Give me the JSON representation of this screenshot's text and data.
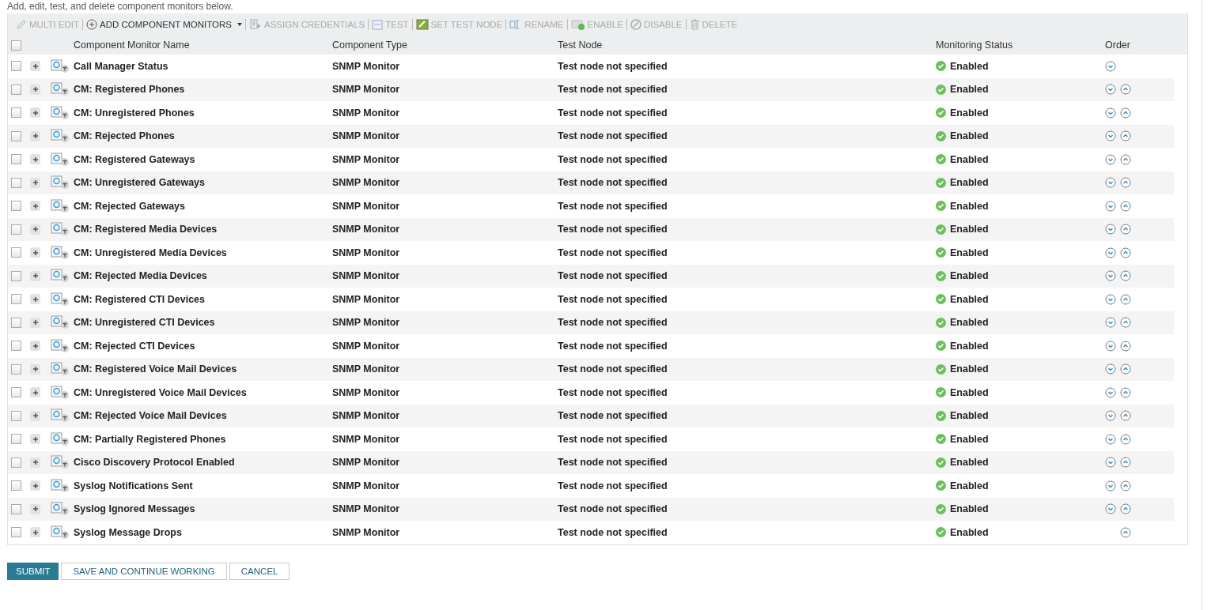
{
  "intro": "Add, edit, test, and delete component monitors below.",
  "toolbar": [
    {
      "kind": "edit",
      "label": "MULTI EDIT",
      "disabled": true
    },
    {
      "kind": "add",
      "label": "ADD COMPONENT MONITORS",
      "disabled": false,
      "dropdown": true
    },
    {
      "kind": "credentials",
      "label": "ASSIGN CREDENTIALS",
      "disabled": true
    },
    {
      "kind": "test",
      "label": "TEST",
      "disabled": true
    },
    {
      "kind": "node",
      "label": "SET TEST NODE",
      "disabled": true
    },
    {
      "kind": "rename",
      "label": "RENAME",
      "disabled": true
    },
    {
      "kind": "enable",
      "label": "ENABLE",
      "disabled": true
    },
    {
      "kind": "disable",
      "label": "DISABLE",
      "disabled": true
    },
    {
      "kind": "delete",
      "label": "DELETE",
      "disabled": true
    }
  ],
  "columns": [
    "Component Monitor Name",
    "Component Type",
    "Test Node",
    "Monitoring Status",
    "Order"
  ],
  "header_checked": false,
  "rows": [
    {
      "name": "Call Manager Status",
      "type": "SNMP Monitor",
      "test_node": "Test node not specified",
      "status": "Enabled",
      "checked": false,
      "down": true,
      "up": false
    },
    {
      "name": "CM: Registered Phones",
      "type": "SNMP Monitor",
      "test_node": "Test node not specified",
      "status": "Enabled",
      "checked": false,
      "down": true,
      "up": true
    },
    {
      "name": "CM: Unregistered Phones",
      "type": "SNMP Monitor",
      "test_node": "Test node not specified",
      "status": "Enabled",
      "checked": false,
      "down": true,
      "up": true
    },
    {
      "name": "CM: Rejected Phones",
      "type": "SNMP Monitor",
      "test_node": "Test node not specified",
      "status": "Enabled",
      "checked": false,
      "down": true,
      "up": true
    },
    {
      "name": "CM: Registered Gateways",
      "type": "SNMP Monitor",
      "test_node": "Test node not specified",
      "status": "Enabled",
      "checked": false,
      "down": true,
      "up": true
    },
    {
      "name": "CM: Unregistered Gateways",
      "type": "SNMP Monitor",
      "test_node": "Test node not specified",
      "status": "Enabled",
      "checked": false,
      "down": true,
      "up": true
    },
    {
      "name": "CM: Rejected Gateways",
      "type": "SNMP Monitor",
      "test_node": "Test node not specified",
      "status": "Enabled",
      "checked": false,
      "down": true,
      "up": true
    },
    {
      "name": "CM: Registered Media Devices",
      "type": "SNMP Monitor",
      "test_node": "Test node not specified",
      "status": "Enabled",
      "checked": false,
      "down": true,
      "up": true
    },
    {
      "name": "CM: Unregistered Media Devices",
      "type": "SNMP Monitor",
      "test_node": "Test node not specified",
      "status": "Enabled",
      "checked": false,
      "down": true,
      "up": true
    },
    {
      "name": "CM: Rejected Media Devices",
      "type": "SNMP Monitor",
      "test_node": "Test node not specified",
      "status": "Enabled",
      "checked": false,
      "down": true,
      "up": true
    },
    {
      "name": "CM: Registered CTI Devices",
      "type": "SNMP Monitor",
      "test_node": "Test node not specified",
      "status": "Enabled",
      "checked": false,
      "down": true,
      "up": true
    },
    {
      "name": "CM: Unregistered CTI Devices",
      "type": "SNMP Monitor",
      "test_node": "Test node not specified",
      "status": "Enabled",
      "checked": false,
      "down": true,
      "up": true
    },
    {
      "name": "CM: Rejected CTI Devices",
      "type": "SNMP Monitor",
      "test_node": "Test node not specified",
      "status": "Enabled",
      "checked": false,
      "down": true,
      "up": true
    },
    {
      "name": "CM: Registered Voice Mail Devices",
      "type": "SNMP Monitor",
      "test_node": "Test node not specified",
      "status": "Enabled",
      "checked": false,
      "down": true,
      "up": true
    },
    {
      "name": "CM: Unregistered Voice Mail Devices",
      "type": "SNMP Monitor",
      "test_node": "Test node not specified",
      "status": "Enabled",
      "checked": false,
      "down": true,
      "up": true
    },
    {
      "name": "CM: Rejected Voice Mail Devices",
      "type": "SNMP Monitor",
      "test_node": "Test node not specified",
      "status": "Enabled",
      "checked": false,
      "down": true,
      "up": true
    },
    {
      "name": "CM: Partially Registered Phones",
      "type": "SNMP Monitor",
      "test_node": "Test node not specified",
      "status": "Enabled",
      "checked": false,
      "down": true,
      "up": true
    },
    {
      "name": "Cisco Discovery Protocol Enabled",
      "type": "SNMP Monitor",
      "test_node": "Test node not specified",
      "status": "Enabled",
      "checked": false,
      "down": true,
      "up": true
    },
    {
      "name": "Syslog Notifications Sent",
      "type": "SNMP Monitor",
      "test_node": "Test node not specified",
      "status": "Enabled",
      "checked": false,
      "down": true,
      "up": true
    },
    {
      "name": "Syslog Ignored Messages",
      "type": "SNMP Monitor",
      "test_node": "Test node not specified",
      "status": "Enabled",
      "checked": false,
      "down": true,
      "up": true
    },
    {
      "name": "Syslog Message Drops",
      "type": "SNMP Monitor",
      "test_node": "Test node not specified",
      "status": "Enabled",
      "checked": false,
      "down": false,
      "up": true
    }
  ],
  "buttons": [
    {
      "label": "SUBMIT",
      "primary": true
    },
    {
      "label": "SAVE AND CONTINUE WORKING",
      "primary": false
    },
    {
      "label": "CANCEL",
      "primary": false
    }
  ]
}
